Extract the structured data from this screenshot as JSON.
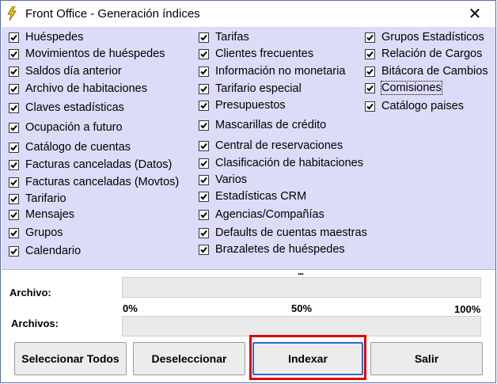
{
  "window": {
    "title": "Front Office - Generación índices",
    "close_glyph": "✕"
  },
  "checkboxes": {
    "column1": [
      {
        "label": "Huéspedes",
        "checked": true
      },
      {
        "label": "Movimientos de huéspedes",
        "checked": true
      },
      {
        "label": "Saldos día anterior",
        "checked": true
      },
      {
        "label": "Archivo de habitaciones",
        "checked": true
      },
      {
        "label": "Claves estadísticas",
        "checked": true
      },
      {
        "label": "Ocupación a futuro",
        "checked": true
      },
      {
        "label": "Catálogo de cuentas",
        "checked": true
      },
      {
        "label": "Facturas canceladas (Datos)",
        "checked": true
      },
      {
        "label": "Facturas canceladas (Movtos)",
        "checked": true
      },
      {
        "label": "Tarifario",
        "checked": true
      },
      {
        "label": "Mensajes",
        "checked": true
      },
      {
        "label": "Grupos",
        "checked": true
      },
      {
        "label": "Calendario",
        "checked": true
      }
    ],
    "column2": [
      {
        "label": "Tarifas",
        "checked": true
      },
      {
        "label": "Clientes frecuentes",
        "checked": true
      },
      {
        "label": "Información no monetaria",
        "checked": true
      },
      {
        "label": "Tarifario especial",
        "checked": true
      },
      {
        "label": "Presupuestos",
        "checked": true
      },
      {
        "label": "Mascarillas de crédito",
        "checked": true
      },
      {
        "label": "Central de reservaciones",
        "checked": true
      },
      {
        "label": "Clasificación de habitaciones",
        "checked": true
      },
      {
        "label": "Varios",
        "checked": true
      },
      {
        "label": "Estadísticas CRM",
        "checked": true
      },
      {
        "label": "Agencias/Compañías",
        "checked": true
      },
      {
        "label": "Defaults de cuentas maestras",
        "checked": true
      },
      {
        "label": "Brazaletes de huéspedes",
        "checked": true
      }
    ],
    "column3": [
      {
        "label": "Grupos Estadísticos",
        "checked": true
      },
      {
        "label": "Relación de Cargos",
        "checked": true
      },
      {
        "label": "Bitácora de Cambios",
        "checked": true
      },
      {
        "label": "Comisiones",
        "checked": true,
        "focused": true
      },
      {
        "label": "Catálogo paises",
        "checked": true
      }
    ]
  },
  "scroll_indicator": "...",
  "progress": {
    "archivo_label": "Archivo:",
    "archivos_label": "Archivos:",
    "archivo_value": 0,
    "archivos_value": 0,
    "scale": [
      "0%",
      "50%",
      "100%"
    ]
  },
  "buttons": {
    "select_all": "Seleccionar Todos",
    "deselect": "Deseleccionar",
    "index": "Indexar",
    "exit": "Salir"
  },
  "colors": {
    "panel_bg": "#dcdcf8",
    "highlight": "#e00000"
  }
}
